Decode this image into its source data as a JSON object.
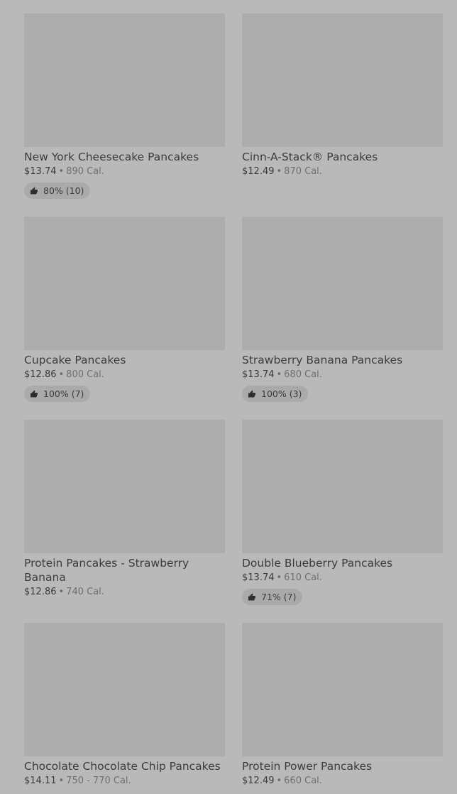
{
  "items": [
    {
      "name": "New York Cheesecake Pancakes",
      "price": "$13.74",
      "calories": "890 Cal.",
      "rating": "80% (10)"
    },
    {
      "name": "Cinn-A-Stack® Pancakes",
      "price": "$12.49",
      "calories": "870 Cal.",
      "rating": ""
    },
    {
      "name": "Cupcake Pancakes",
      "price": "$12.86",
      "calories": "800 Cal.",
      "rating": "100% (7)"
    },
    {
      "name": "Strawberry Banana Pancakes",
      "price": "$13.74",
      "calories": "680 Cal.",
      "rating": "100% (3)"
    },
    {
      "name": "Protein Pancakes - Strawberry Banana",
      "price": "$12.86",
      "calories": "740 Cal.",
      "rating": ""
    },
    {
      "name": "Double Blueberry Pancakes",
      "price": "$13.74",
      "calories": "610 Cal.",
      "rating": "71% (7)"
    },
    {
      "name": "Chocolate Chocolate Chip Pancakes",
      "price": "$14.11",
      "calories": "750 - 770 Cal.",
      "rating": ""
    },
    {
      "name": "Protein Power Pancakes",
      "price": "$12.49",
      "calories": "660 Cal.",
      "rating": ""
    }
  ],
  "separator": "•",
  "icons": {
    "rating": "thumbs-up-icon"
  },
  "colors": {
    "background": "#b9b9b9",
    "image_placeholder": "#adadad",
    "rating_pill": "#aaaaaa"
  }
}
